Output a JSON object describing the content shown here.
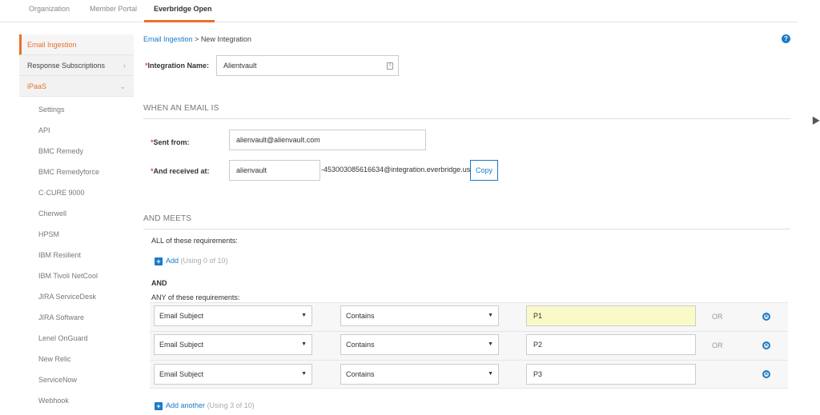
{
  "topnav": {
    "tabs": [
      {
        "label": "Organization"
      },
      {
        "label": "Member Portal"
      },
      {
        "label": "Everbridge Open"
      }
    ]
  },
  "sidebar": {
    "items": [
      {
        "label": "Email Ingestion"
      },
      {
        "label": "Response Subscriptions"
      },
      {
        "label": "iPaaS"
      }
    ],
    "subitems": [
      "Settings",
      "API",
      "BMC Remedy",
      "BMC Remedyforce",
      "C·CURE 9000",
      "Cherwell",
      "HPSM",
      "IBM Resilient",
      "IBM Tivoli NetCool",
      "JIRA ServiceDesk",
      "JIRA Software",
      "Lenel OnGuard",
      "New Relic",
      "ServiceNow",
      "Webhook"
    ]
  },
  "breadcrumb": {
    "parent": "Email Ingestion",
    "separator": " > ",
    "current": "New Integration"
  },
  "help_icon": "question-icon",
  "integration": {
    "name_label": "Integration Name:",
    "name_value": "Alientvault"
  },
  "when_email": {
    "title": "WHEN AN EMAIL IS",
    "sent_from_label": "Sent from:",
    "sent_from_value": "alienvault@alienvault.com",
    "received_label": "And received at:",
    "received_value": "alienvault",
    "domain_suffix": "-453003085616634@integration.everbridge.us",
    "copy_label": "Copy"
  },
  "and_meets": {
    "title": "AND MEETS",
    "all_label": "ALL of these requirements:",
    "add_label": "Add",
    "add_usage": "(Using 0 of 10)",
    "and_label": "AND",
    "any_label": "ANY of these requirements:",
    "rows": [
      {
        "field": "Email Subject",
        "operator": "Contains",
        "value": "P1",
        "or": "OR"
      },
      {
        "field": "Email Subject",
        "operator": "Contains",
        "value": "P2",
        "or": "OR"
      },
      {
        "field": "Email Subject",
        "operator": "Contains",
        "value": "P3",
        "or": ""
      }
    ],
    "add_another_label": "Add another",
    "add_another_usage": "(Using 3 of 10)"
  },
  "colors": {
    "accent": "#e8702a",
    "link": "#1b7ac7",
    "highlight": "#fafac8"
  }
}
